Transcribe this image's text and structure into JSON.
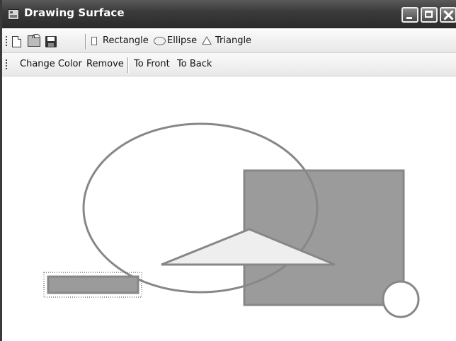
{
  "window": {
    "title": "Drawing Surface"
  },
  "toolbar_main": {
    "new_icon": "new-file-icon",
    "open_icon": "open-folder-icon",
    "save_icon": "save-disk-icon",
    "rectangle_label": "Rectangle",
    "ellipse_label": "Ellipse",
    "triangle_label": "Triangle"
  },
  "toolbar_edit": {
    "change_color_label": "Change Color",
    "remove_label": "Remove",
    "to_front_label": "To Front",
    "to_back_label": "To Back"
  },
  "colors": {
    "shape_fill": "#9b9b9b",
    "shape_stroke": "#878787",
    "triangle_fill": "#eeeeee",
    "circle_fill": "#ffffff"
  }
}
